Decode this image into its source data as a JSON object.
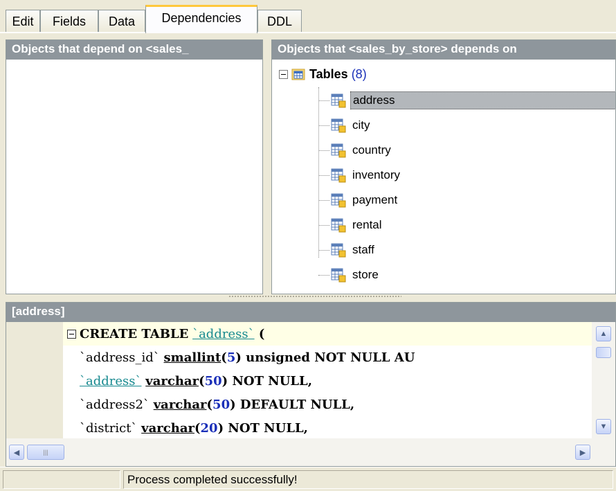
{
  "tabs": [
    {
      "label": "Edit",
      "active": false
    },
    {
      "label": "Fields",
      "active": false
    },
    {
      "label": "Data",
      "active": false
    },
    {
      "label": "Dependencies",
      "active": true
    },
    {
      "label": "DDL",
      "active": false
    }
  ],
  "left_panel": {
    "title": "Objects that depend on <sales_"
  },
  "right_panel": {
    "title": "Objects that <sales_by_store> depends on",
    "tree": {
      "root_label": "Tables",
      "root_count": "(8)",
      "root_icon": "tables-folder-icon",
      "items": [
        {
          "label": "address",
          "selected": true
        },
        {
          "label": "city",
          "selected": false
        },
        {
          "label": "country",
          "selected": false
        },
        {
          "label": "inventory",
          "selected": false
        },
        {
          "label": "payment",
          "selected": false
        },
        {
          "label": "rental",
          "selected": false
        },
        {
          "label": "staff",
          "selected": false
        },
        {
          "label": "store",
          "selected": false
        }
      ]
    }
  },
  "code_panel": {
    "title": "[address]",
    "lines": [
      {
        "kw1": "CREATE TABLE",
        "ident": "`address`",
        "tail": " ("
      },
      {
        "ident": "`address_id`",
        "type": "smallint",
        "num": "5",
        "rest": " unsigned NOT NULL AU"
      },
      {
        "ident": "`address`",
        "type": "varchar",
        "num": "50",
        "rest": " NOT NULL,"
      },
      {
        "ident": "`address2`",
        "type": "varchar",
        "num": "50",
        "rest": " DEFAULT NULL,"
      },
      {
        "ident": "`district`",
        "type": "varchar",
        "num": "20",
        "rest": " NOT NULL,"
      }
    ]
  },
  "status": {
    "message": "Process completed successfully!"
  },
  "colors": {
    "panel_header": "#8e969c",
    "selection": "#b3b7bb",
    "identifier": "#16898f",
    "number": "#1a2fb8",
    "active_tab_accent": "#ffc83c"
  }
}
